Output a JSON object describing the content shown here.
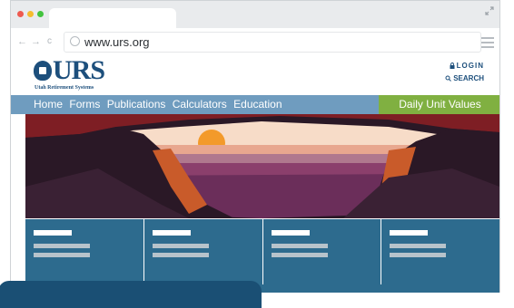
{
  "browser": {
    "url": "www.urs.org",
    "nav": {
      "back": "←",
      "forward": "→",
      "reload": "c"
    }
  },
  "site": {
    "logo": {
      "name": "URS",
      "subtitle": "Utah Retirement Systems"
    },
    "header_links": {
      "login": "LOGIN",
      "search": "SEARCH"
    },
    "nav_items": [
      "Home",
      "Forms",
      "Publications",
      "Calculators",
      "Education"
    ],
    "daily_button": "Daily Unit Values"
  },
  "colors": {
    "brand": "#1d4f7c",
    "nav": "#6f9cbf",
    "daily_button": "#80b041",
    "tile": "#2d6b8e"
  },
  "tiles": [
    {},
    {},
    {},
    {}
  ]
}
